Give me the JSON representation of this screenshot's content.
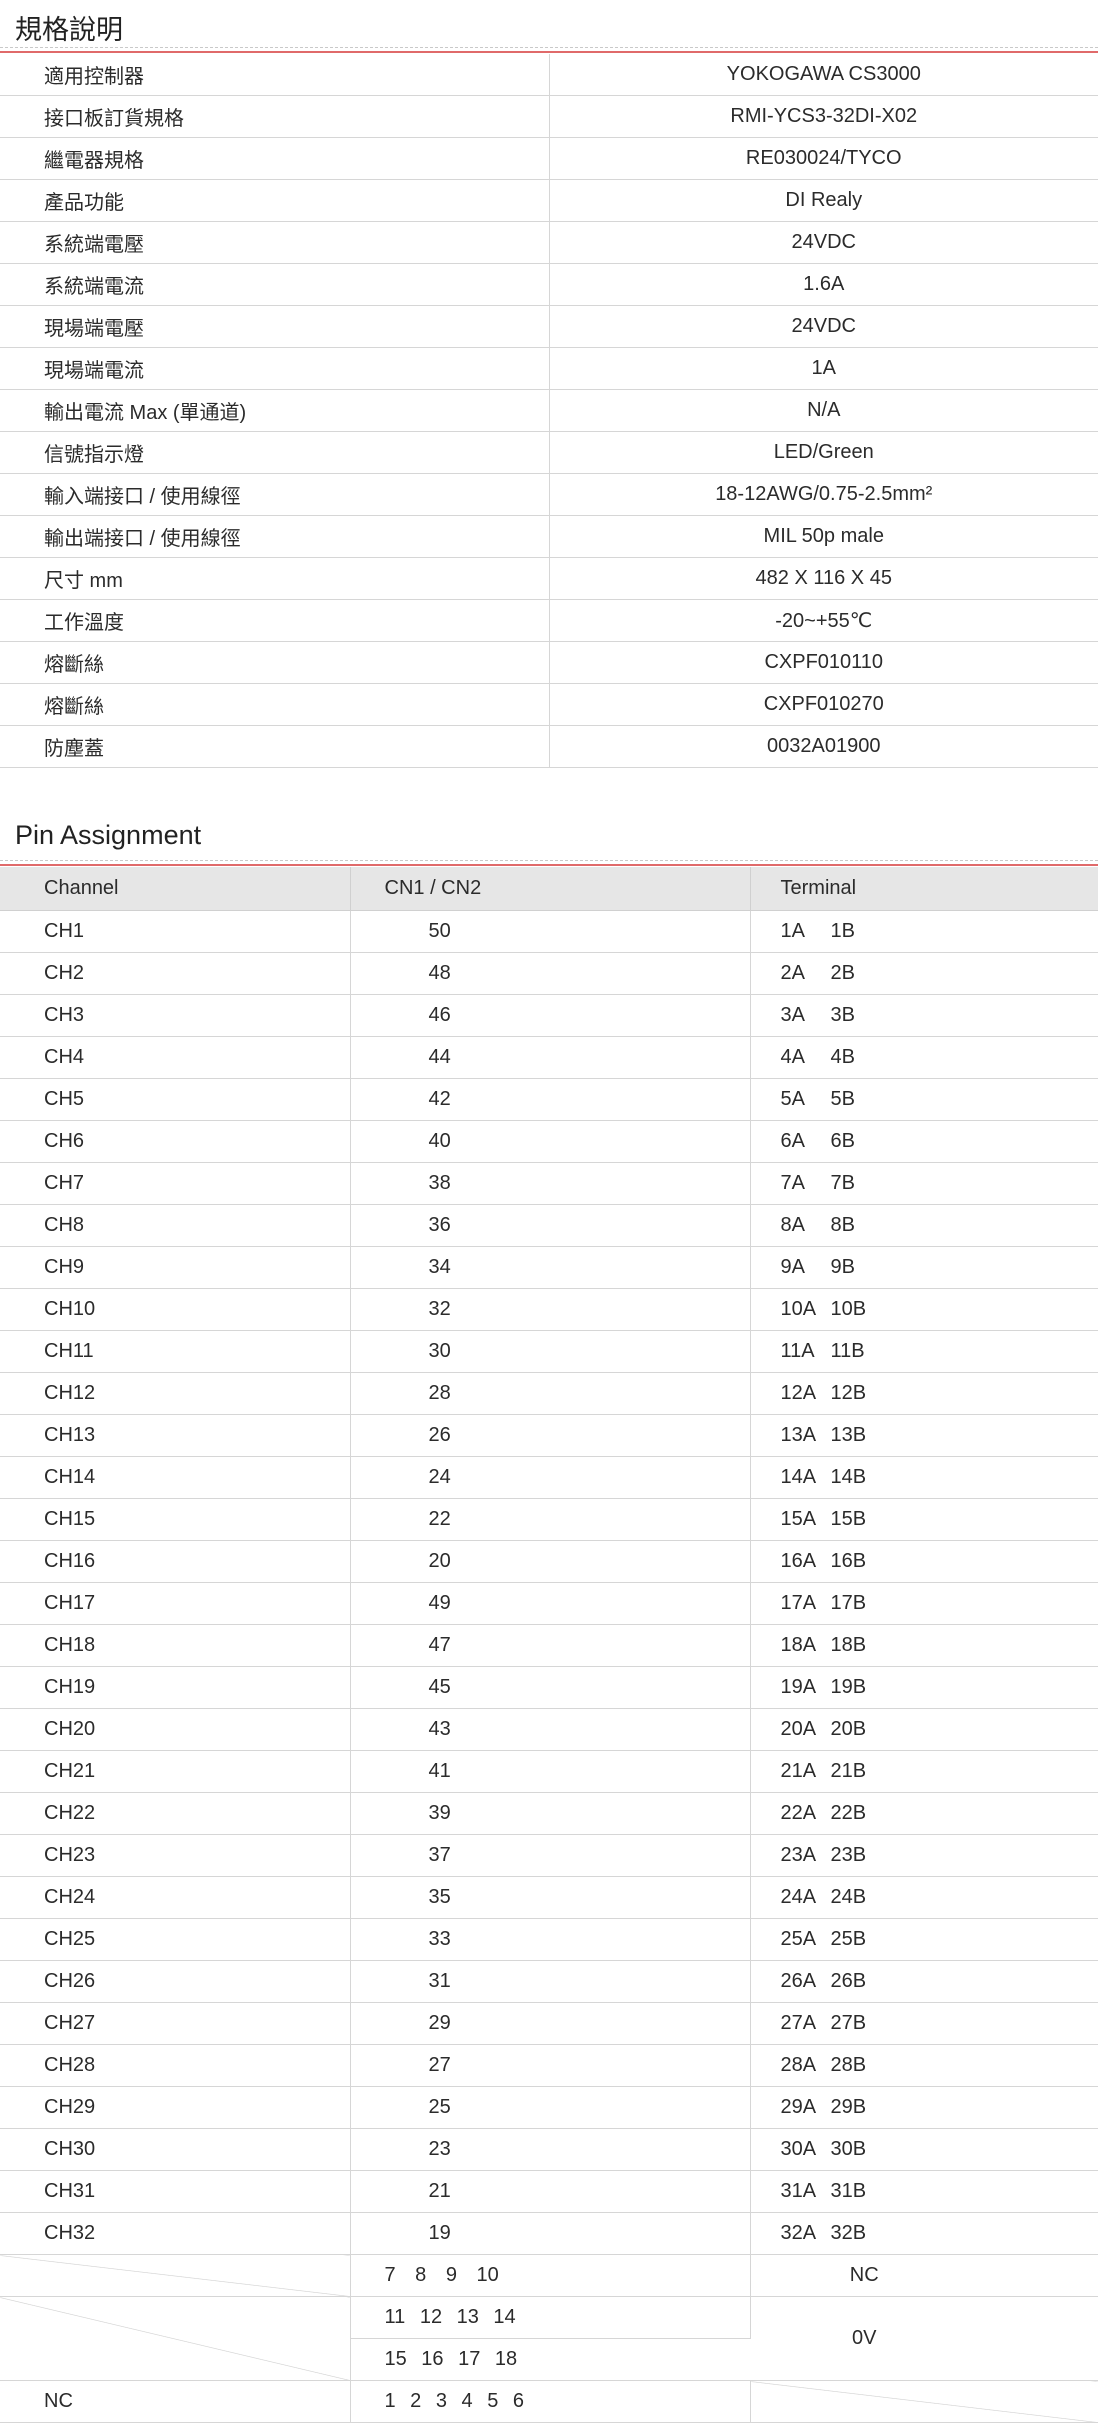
{
  "spec": {
    "title": "規格說明",
    "rows": [
      {
        "label": "適用控制器",
        "value": "YOKOGAWA  CS3000"
      },
      {
        "label": "接口板訂貨規格",
        "value": "RMI-YCS3-32DI-X02"
      },
      {
        "label": "繼電器規格",
        "value": "RE030024/TYCO"
      },
      {
        "label": "產品功能",
        "value": "DI  Realy"
      },
      {
        "label": "系統端電壓",
        "value": "24VDC"
      },
      {
        "label": "系統端電流",
        "value": "1.6A"
      },
      {
        "label": "現場端電壓",
        "value": "24VDC"
      },
      {
        "label": "現場端電流",
        "value": "1A"
      },
      {
        "label": "輸出電流 Max (單通道)",
        "value": "N/A"
      },
      {
        "label": "信號指示燈",
        "value": "LED/Green"
      },
      {
        "label": "輸入端接口 / 使用線徑",
        "value": "18-12AWG/0.75-2.5mm²"
      },
      {
        "label": "輸出端接口 / 使用線徑",
        "value": "MIL  50p   male"
      },
      {
        "label": "尺寸 mm",
        "value": "482 X 116 X 45"
      },
      {
        "label": "工作溫度",
        "value": "-20~+55℃"
      },
      {
        "label": "熔斷絲",
        "value": "CXPF010110"
      },
      {
        "label": "熔斷絲",
        "value": "CXPF010270"
      },
      {
        "label": "防塵蓋",
        "value": "0032A01900"
      }
    ]
  },
  "pin": {
    "title": "Pin Assignment",
    "headers": {
      "channel": "Channel",
      "cn": "CN1 / CN2",
      "terminal": "Terminal"
    },
    "rows": [
      {
        "ch": "CH1",
        "cn": "50",
        "ta": "1A",
        "tb": "1B"
      },
      {
        "ch": "CH2",
        "cn": "48",
        "ta": "2A",
        "tb": "2B"
      },
      {
        "ch": "CH3",
        "cn": "46",
        "ta": "3A",
        "tb": "3B"
      },
      {
        "ch": "CH4",
        "cn": "44",
        "ta": "4A",
        "tb": "4B"
      },
      {
        "ch": "CH5",
        "cn": "42",
        "ta": "5A",
        "tb": "5B"
      },
      {
        "ch": "CH6",
        "cn": "40",
        "ta": "6A",
        "tb": "6B"
      },
      {
        "ch": "CH7",
        "cn": "38",
        "ta": "7A",
        "tb": "7B"
      },
      {
        "ch": "CH8",
        "cn": "36",
        "ta": "8A",
        "tb": "8B"
      },
      {
        "ch": "CH9",
        "cn": "34",
        "ta": "9A",
        "tb": "9B"
      },
      {
        "ch": "CH10",
        "cn": "32",
        "ta": "10A",
        "tb": "10B"
      },
      {
        "ch": "CH11",
        "cn": "30",
        "ta": "11A",
        "tb": "11B"
      },
      {
        "ch": "CH12",
        "cn": "28",
        "ta": "12A",
        "tb": "12B"
      },
      {
        "ch": "CH13",
        "cn": "26",
        "ta": "13A",
        "tb": "13B"
      },
      {
        "ch": "CH14",
        "cn": "24",
        "ta": "14A",
        "tb": "14B"
      },
      {
        "ch": "CH15",
        "cn": "22",
        "ta": "15A",
        "tb": "15B"
      },
      {
        "ch": "CH16",
        "cn": "20",
        "ta": "16A",
        "tb": "16B"
      },
      {
        "ch": "CH17",
        "cn": "49",
        "ta": "17A",
        "tb": "17B"
      },
      {
        "ch": "CH18",
        "cn": "47",
        "ta": "18A",
        "tb": "18B"
      },
      {
        "ch": "CH19",
        "cn": "45",
        "ta": "19A",
        "tb": "19B"
      },
      {
        "ch": "CH20",
        "cn": "43",
        "ta": "20A",
        "tb": "20B"
      },
      {
        "ch": "CH21",
        "cn": "41",
        "ta": "21A",
        "tb": "21B"
      },
      {
        "ch": "CH22",
        "cn": "39",
        "ta": "22A",
        "tb": "22B"
      },
      {
        "ch": "CH23",
        "cn": "37",
        "ta": "23A",
        "tb": "23B"
      },
      {
        "ch": "CH24",
        "cn": "35",
        "ta": "24A",
        "tb": "24B"
      },
      {
        "ch": "CH25",
        "cn": "33",
        "ta": "25A",
        "tb": "25B"
      },
      {
        "ch": "CH26",
        "cn": "31",
        "ta": "26A",
        "tb": "26B"
      },
      {
        "ch": "CH27",
        "cn": "29",
        "ta": "27A",
        "tb": "27B"
      },
      {
        "ch": "CH28",
        "cn": "27",
        "ta": "28A",
        "tb": "28B"
      },
      {
        "ch": "CH29",
        "cn": "25",
        "ta": "29A",
        "tb": "29B"
      },
      {
        "ch": "CH30",
        "cn": "23",
        "ta": "30A",
        "tb": "30B"
      },
      {
        "ch": "CH31",
        "cn": "21",
        "ta": "31A",
        "tb": "31B"
      },
      {
        "ch": "CH32",
        "cn": "19",
        "ta": "32A",
        "tb": "32B"
      }
    ],
    "extra": {
      "nc_pins": "7  8  9  10",
      "nc_terminal": "NC",
      "ov_pins_1": "11  12  13  14",
      "ov_pins_2": "15  16  17  18",
      "ov_terminal": "0V",
      "nc_label": "NC",
      "nc_pins_2": "1 2 3 4 5 6"
    }
  }
}
